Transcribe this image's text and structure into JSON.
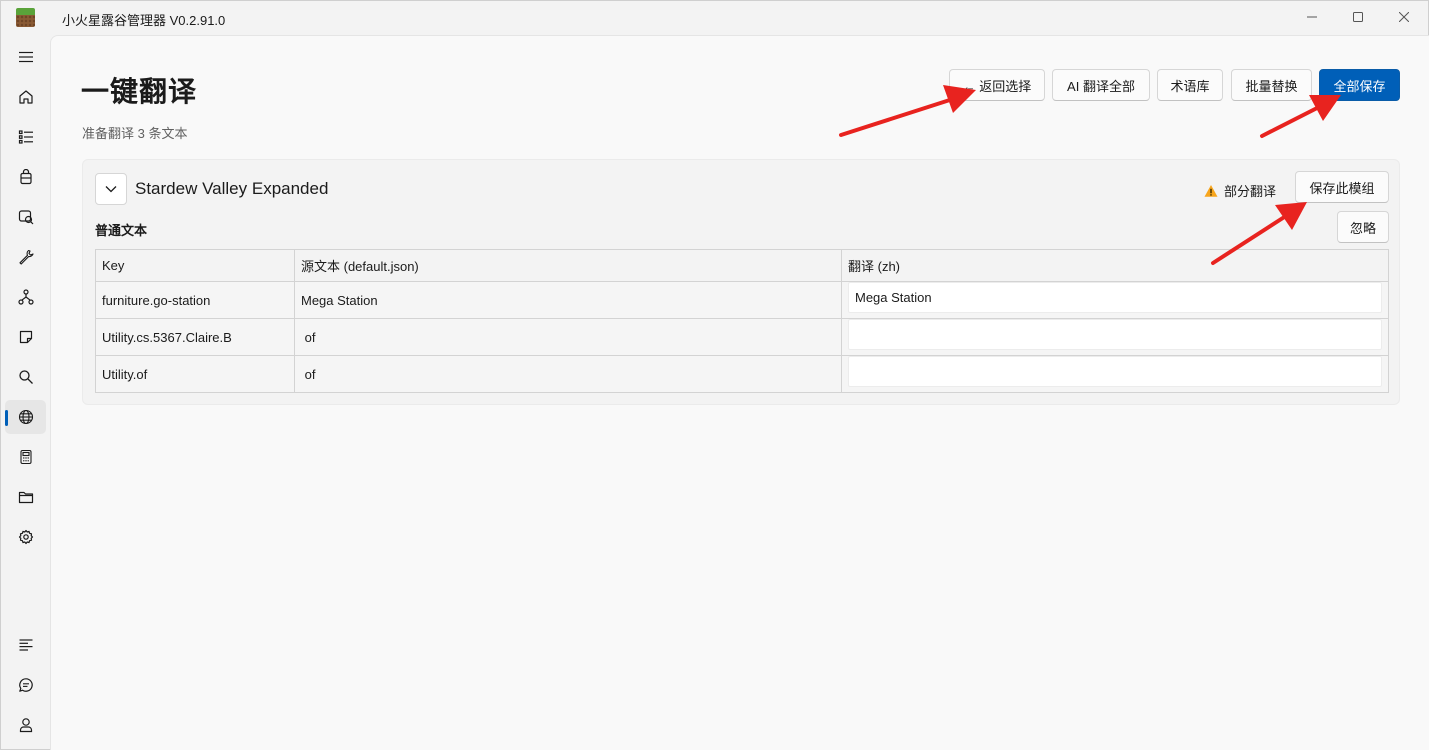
{
  "window": {
    "title": "小火星露谷管理器 V0.2.91.0"
  },
  "sidebar": {
    "items": [
      {
        "name": "menu",
        "icon": "hamburger-icon"
      },
      {
        "name": "home",
        "icon": "home-icon"
      },
      {
        "name": "list",
        "icon": "list-icon"
      },
      {
        "name": "bag",
        "icon": "bag-icon"
      },
      {
        "name": "image-search",
        "icon": "image-search-icon"
      },
      {
        "name": "tools",
        "icon": "wrench-icon"
      },
      {
        "name": "tree",
        "icon": "hierarchy-icon"
      },
      {
        "name": "note",
        "icon": "note-icon"
      },
      {
        "name": "search",
        "icon": "search-icon"
      },
      {
        "name": "translate",
        "icon": "globe-icon",
        "active": true
      },
      {
        "name": "calculator",
        "icon": "calculator-icon"
      },
      {
        "name": "folder",
        "icon": "folder-icon"
      },
      {
        "name": "settings",
        "icon": "gear-icon"
      }
    ],
    "bottom_items": [
      {
        "name": "log",
        "icon": "lines-icon"
      },
      {
        "name": "feedback",
        "icon": "chat-icon"
      },
      {
        "name": "account",
        "icon": "user-icon"
      }
    ]
  },
  "page": {
    "title": "一键翻译",
    "subtitle": "准备翻译 3 条文本"
  },
  "toolbar": {
    "back_label": "← 返回选择",
    "ai_translate_label": "AI 翻译全部",
    "glossary_label": "术语库",
    "batch_replace_label": "批量替换",
    "save_all_label": "全部保存"
  },
  "group": {
    "title": "Stardew Valley Expanded",
    "status": "部分翻译",
    "save_group_label": "保存此模组",
    "ignore_label": "忽略",
    "section_title": "普通文本",
    "columns": [
      "Key",
      "源文本 (default.json)",
      "翻译 (zh)"
    ],
    "rows": [
      {
        "key": "furniture.go-station",
        "source": "Mega Station",
        "translation": "Mega Station"
      },
      {
        "key": "Utility.cs.5367.Claire.B",
        "source": " of",
        "translation": ""
      },
      {
        "key": "Utility.of",
        "source": " of",
        "translation": ""
      }
    ]
  },
  "colors": {
    "accent": "#005fb8",
    "warning": "#f7a51c",
    "annotation_arrow": "#e8231f"
  }
}
